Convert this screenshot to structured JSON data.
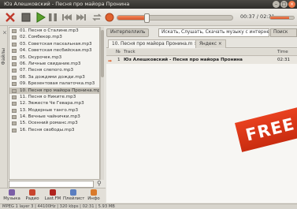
{
  "window": {
    "title": "Юз Алешковский - Песня про майора Пронина"
  },
  "player": {
    "time": "00:37 / 02:31",
    "progress": 0.25,
    "volume": 0.8
  },
  "sidebar": {
    "tab_label": "Файлы",
    "files": [
      "01. Песня о Сталине.mp3",
      "02. Сомбекор.mp3",
      "03. Советская пасхальная.mp3",
      "04. Советская песбийская.mp3",
      "05. Окурочек.mp3",
      "06. Личные свидание.mp3",
      "07. Песня слепого.mp3",
      "08. За дождями дожди.mp3",
      "09. Брезентовая палаточка.mp3",
      "10. Песня про майора Пронина.mp3",
      "11. Песня о Никите.mp3",
      "12. Эвжеств Че Гевара.mp3",
      "13. Модерные танго.mp3",
      "14. Вечные чайнички.mp3",
      "15. Осенний романс.mp3",
      "16. Песня свободы.mp3"
    ],
    "selected_index": 9,
    "search_placeholder": ""
  },
  "bottom_nav": [
    {
      "label": "Музыка",
      "color": "#7b5ea7"
    },
    {
      "label": "Радио",
      "color": "#c8442e"
    },
    {
      "label": "Last.FM",
      "color": "#b0231e"
    },
    {
      "label": "Плейлист",
      "color": "#5a7ec0"
    },
    {
      "label": "Инфо",
      "color": "#d97a2b"
    }
  ],
  "main": {
    "source_tag": "Интерпеллиль",
    "search_text": "Искать, Слушать, Скачать музыку с интернет",
    "search_button": "Поиск",
    "tabs": [
      {
        "label": "10. Песня про майора Пронина.m ×"
      },
      {
        "label": "Яндекс ×"
      }
    ],
    "columns": {
      "pos": "№",
      "track": "Track",
      "time": "Time"
    },
    "tracks": [
      {
        "num": "1",
        "name": "Юз Алешковский - Песня про майора Пронина",
        "time": "02:31"
      }
    ],
    "banner": "FREE"
  },
  "status": "MPEG 1 layer 3 | 44100Hz | 320 kbps | 02:31 | 5.93 MB"
}
